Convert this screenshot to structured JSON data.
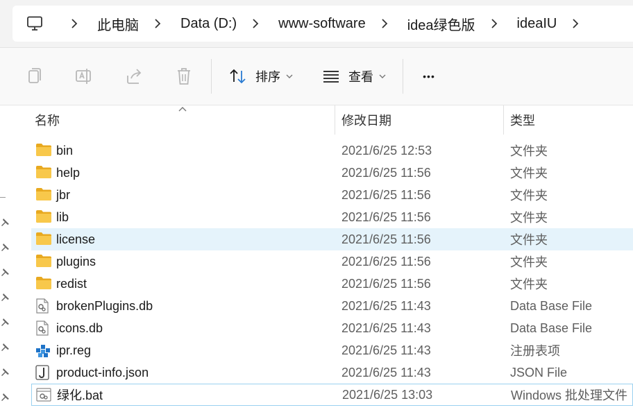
{
  "address_bar": {
    "crumbs": [
      "此电脑",
      "Data (D:)",
      "www-software",
      "idea绿色版",
      "ideaIU"
    ]
  },
  "toolbar": {
    "sort_label": "排序",
    "view_label": "查看",
    "more_label": "•••"
  },
  "columns": {
    "name": "名称",
    "modified": "修改日期",
    "type": "类型"
  },
  "files": [
    {
      "name": "bin",
      "modified": "2021/6/25 12:53",
      "type": "文件夹",
      "icon": "folder-icon"
    },
    {
      "name": "help",
      "modified": "2021/6/25 11:56",
      "type": "文件夹",
      "icon": "folder-icon"
    },
    {
      "name": "jbr",
      "modified": "2021/6/25 11:56",
      "type": "文件夹",
      "icon": "folder-icon"
    },
    {
      "name": "lib",
      "modified": "2021/6/25 11:56",
      "type": "文件夹",
      "icon": "folder-icon"
    },
    {
      "name": "license",
      "modified": "2021/6/25 11:56",
      "type": "文件夹",
      "icon": "folder-icon"
    },
    {
      "name": "plugins",
      "modified": "2021/6/25 11:56",
      "type": "文件夹",
      "icon": "folder-icon"
    },
    {
      "name": "redist",
      "modified": "2021/6/25 11:56",
      "type": "文件夹",
      "icon": "folder-icon"
    },
    {
      "name": "brokenPlugins.db",
      "modified": "2021/6/25 11:43",
      "type": "Data Base File",
      "icon": "db-file-icon"
    },
    {
      "name": "icons.db",
      "modified": "2021/6/25 11:43",
      "type": "Data Base File",
      "icon": "db-file-icon"
    },
    {
      "name": "ipr.reg",
      "modified": "2021/6/25 11:43",
      "type": "注册表项",
      "icon": "registry-file-icon"
    },
    {
      "name": "product-info.json",
      "modified": "2021/6/25 11:43",
      "type": "JSON File",
      "icon": "json-file-icon"
    },
    {
      "name": "绿化.bat",
      "modified": "2021/6/25 13:03",
      "type": "Windows 批处理文件",
      "icon": "batch-file-icon"
    }
  ],
  "colors": {
    "hover_row": "#e5f3fb",
    "focus_border": "#99d1f0",
    "folder_yellow": "#f8c84b"
  }
}
